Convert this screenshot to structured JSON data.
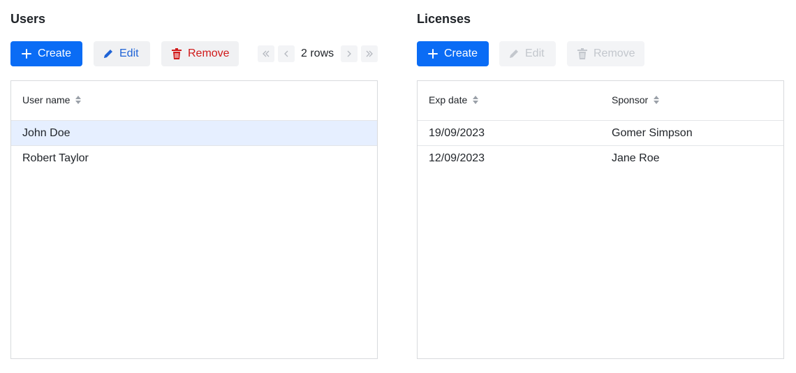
{
  "users": {
    "title": "Users",
    "create_label": "Create",
    "edit_label": "Edit",
    "remove_label": "Remove",
    "pager_label": "2 rows",
    "column_username": "User name",
    "rows": [
      {
        "username": "John Doe",
        "selected": true
      },
      {
        "username": "Robert Taylor",
        "selected": false
      }
    ]
  },
  "licenses": {
    "title": "Licenses",
    "create_label": "Create",
    "edit_label": "Edit",
    "remove_label": "Remove",
    "column_expdate": "Exp date",
    "column_sponsor": "Sponsor",
    "rows": [
      {
        "exp_date": "19/09/2023",
        "sponsor": "Gomer Simpson"
      },
      {
        "exp_date": "12/09/2023",
        "sponsor": "Jane Roe"
      }
    ]
  },
  "colors": {
    "primary": "#0a6cf5",
    "edit": "#1f63d6",
    "remove": "#d01919",
    "selected_row": "#e6efff",
    "disabled": "#c3c7cd"
  },
  "icons": {
    "create": "plus-icon",
    "edit": "pencil-icon",
    "remove": "trash-icon",
    "first": "double-chevron-left-icon",
    "prev": "chevron-left-icon",
    "next": "chevron-right-icon",
    "last": "double-chevron-right-icon",
    "sort": "sort-icon"
  }
}
